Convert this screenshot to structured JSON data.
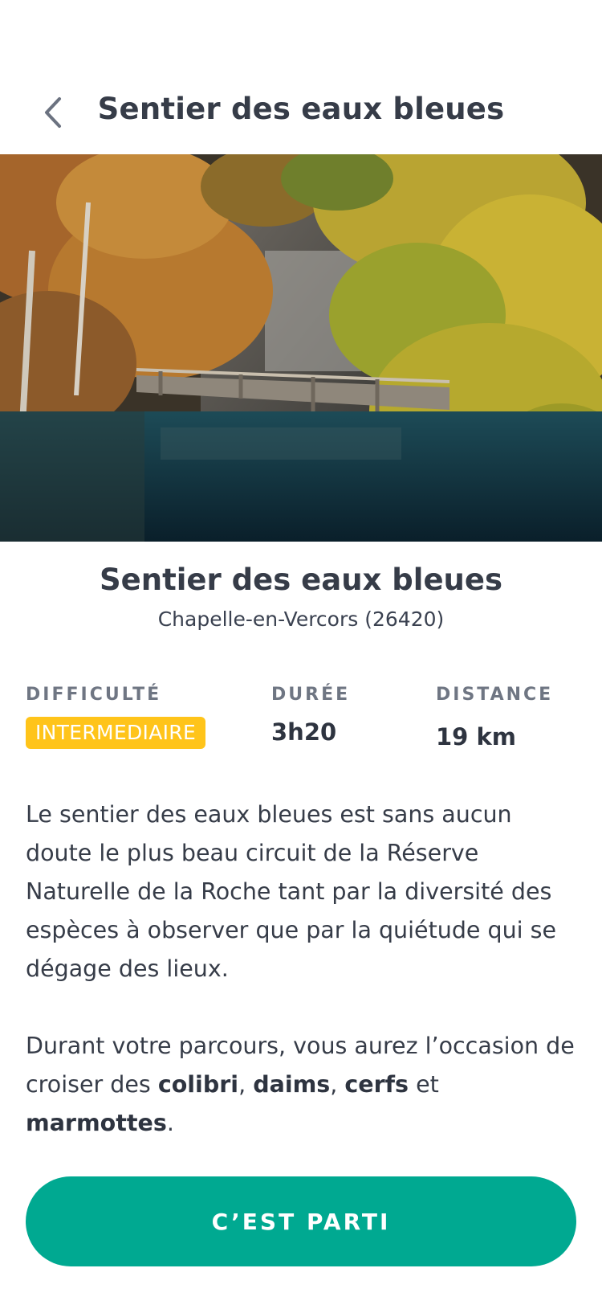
{
  "header": {
    "back_icon": "chevron-left-icon",
    "title": "Sentier des eaux bleues"
  },
  "hero": {
    "subject": "autumn trees over a blue lake with wooden footbridge"
  },
  "trail": {
    "name": "Sentier des eaux bleues",
    "location": "Chapelle-en-Vercors (26420)"
  },
  "stats": {
    "difficulty_label": "DIFFICULTÉ",
    "difficulty_value": "INTERMEDIAIRE",
    "duration_label": "DURÉE",
    "duration_value": "3h20",
    "distance_label": "DISTANCE",
    "distance_value": "19 km"
  },
  "description": {
    "paragraph1": "Le sentier des eaux bleues est sans aucun doute le plus beau circuit de la Réserve Naturelle de la Roche tant par la diversité des espèces à observer que par la quiétude qui se dégage des lieux.",
    "p2_intro": "Durant votre parcours, vous aurez l’occasion de croiser des ",
    "animal1": "colibri",
    "sep1": ", ",
    "animal2": "daims",
    "sep2": ", ",
    "animal3": "cerfs",
    "sep3": " et ",
    "animal4": "marmottes",
    "end": "."
  },
  "cta": {
    "label": "C’EST PARTI"
  },
  "colors": {
    "accent": "#00a991",
    "badge": "#ffc41a",
    "text": "#363c48",
    "muted": "#6f7683"
  }
}
